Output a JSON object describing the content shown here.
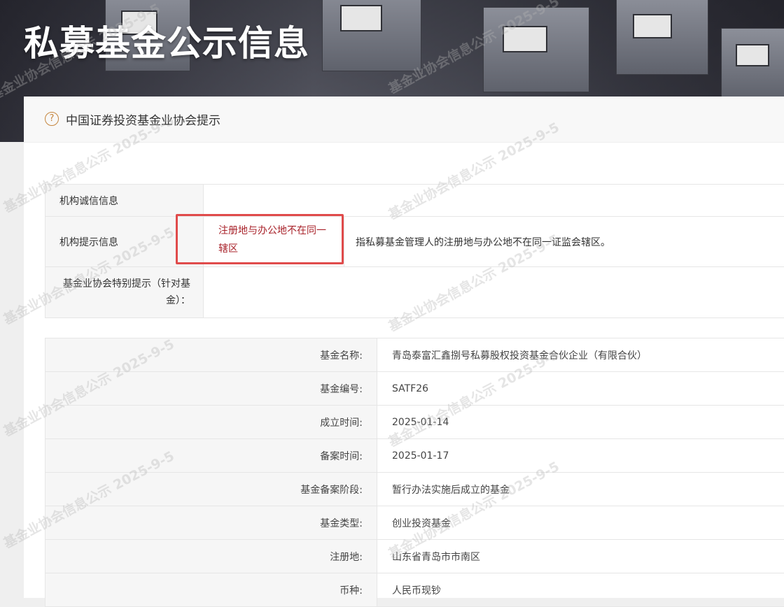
{
  "header": {
    "title": "私募基金公示信息"
  },
  "notice": {
    "text": "中国证券投资基金业协会提示",
    "icon": "question-circle-icon"
  },
  "integrity": {
    "row1_label": "机构诚信信息",
    "row2_label": "机构提示信息",
    "row2_tag": "注册地与办公地不在同一辖区",
    "row2_desc": "指私募基金管理人的注册地与办公地不在同一证监会辖区。",
    "row3_label": "基金业协会特别提示（针对基金）："
  },
  "fund": {
    "rows": [
      {
        "key": "基金名称:",
        "value": "青岛泰富汇鑫捌号私募股权投资基金合伙企业（有限合伙）"
      },
      {
        "key": "基金编号:",
        "value": "SATF26"
      },
      {
        "key": "成立时间:",
        "value": "2025-01-14"
      },
      {
        "key": "备案时间:",
        "value": "2025-01-17"
      },
      {
        "key": "基金备案阶段:",
        "value": "暂行办法实施后成立的基金"
      },
      {
        "key": "基金类型:",
        "value": "创业投资基金"
      },
      {
        "key": "注册地:",
        "value": "山东省青岛市市南区"
      },
      {
        "key": "币种:",
        "value": "人民币现钞"
      }
    ]
  },
  "watermark": {
    "text": "基金业协会信息公示 2025-9-5"
  },
  "colors": {
    "accent": "#c5863f",
    "warn_border": "#e04b4b",
    "warn_text": "#a8222a"
  }
}
